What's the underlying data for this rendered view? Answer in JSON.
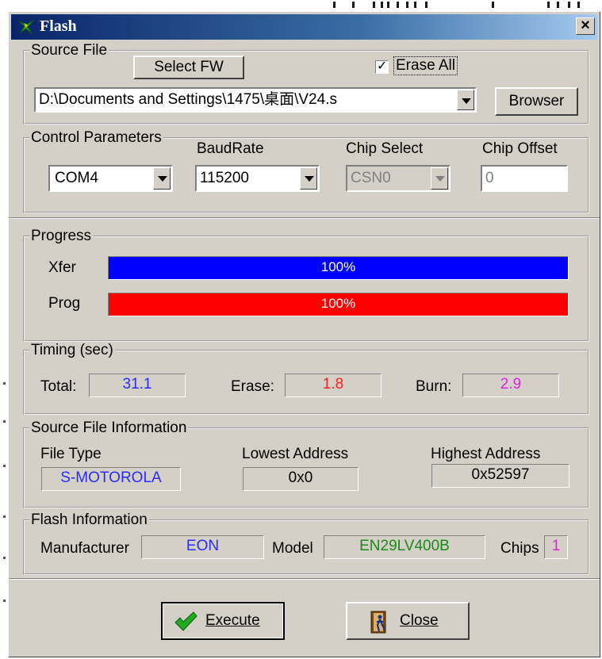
{
  "window": {
    "title": "Flash",
    "close_glyph": "×"
  },
  "source_file": {
    "legend": "Source File",
    "select_fw_label": "Select FW",
    "erase_all": {
      "label": "Erase All",
      "checked": true
    },
    "path_value": "D:\\Documents and Settings\\1475\\桌面\\V24.s",
    "browser_label": "Browser"
  },
  "control": {
    "legend": "Control Parameters",
    "port_value": "COM4",
    "baud_label": "BaudRate",
    "baud_value": "115200",
    "chip_select_label": "Chip Select",
    "chip_select_value": "CSN0",
    "chip_offset_label": "Chip Offset",
    "chip_offset_value": "0"
  },
  "progress": {
    "legend": "Progress",
    "xfer": {
      "label": "Xfer",
      "value": 1.0,
      "text": "100%",
      "color": "#0000ff"
    },
    "prog": {
      "label": "Prog",
      "value": 1.0,
      "text": "100%",
      "color": "#ff0000"
    }
  },
  "timing": {
    "legend": "Timing (sec)",
    "total_label": "Total:",
    "total_value": "31.1",
    "total_color": "#2a2aff",
    "erase_label": "Erase:",
    "erase_value": "1.8",
    "erase_color": "#ff2020",
    "burn_label": "Burn:",
    "burn_value": "2.9",
    "burn_color": "#e020e0"
  },
  "source_info": {
    "legend": "Source File Information",
    "file_type_label": "File Type",
    "file_type_value": "S-MOTOROLA",
    "lowest_label": "Lowest Address",
    "lowest_value": "0x0",
    "highest_label": "Highest Address",
    "highest_value": "0x52597"
  },
  "flash_info": {
    "legend": "Flash Information",
    "manufacturer_label": "Manufacturer",
    "manufacturer_value": "EON",
    "model_label": "Model",
    "model_value": "EN29LV400B",
    "chips_label": "Chips",
    "chips_value": "1"
  },
  "actions": {
    "execute_label": "Execute",
    "close_label": "Close"
  },
  "icons": {
    "app": "flash-app-icon",
    "execute": "checkmark-icon",
    "close": "door-exit-icon",
    "dropdown": "chevron-down-icon"
  }
}
